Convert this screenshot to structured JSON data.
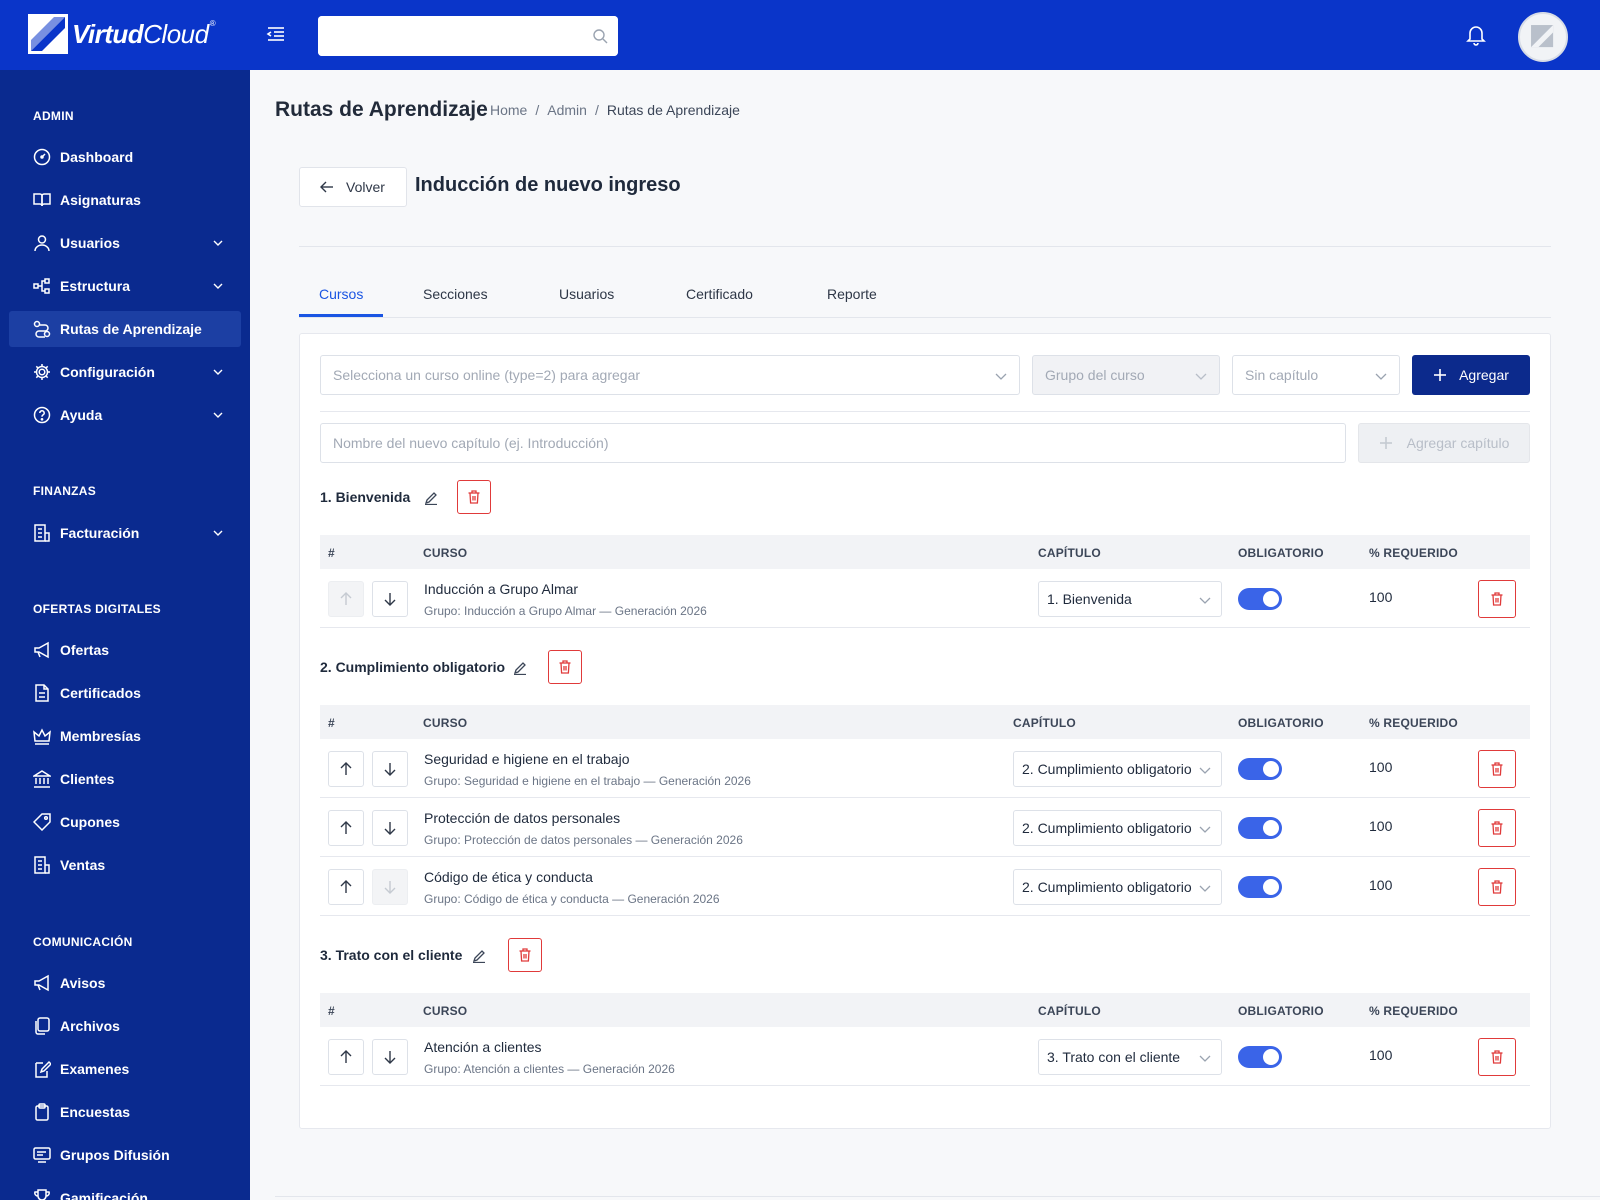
{
  "brand": {
    "name_bold": "Virtud",
    "name_light": "Cloud",
    "mark": "®"
  },
  "header": {
    "search_placeholder": "",
    "search_value": ""
  },
  "sidebar": {
    "sections": [
      {
        "title": "ADMIN",
        "items": [
          {
            "label": "Dashboard",
            "icon": "dashboard-icon",
            "chevron": false
          },
          {
            "label": "Asignaturas",
            "icon": "book-icon",
            "chevron": false
          },
          {
            "label": "Usuarios",
            "icon": "user-icon",
            "chevron": true
          },
          {
            "label": "Estructura",
            "icon": "structure-icon",
            "chevron": true
          },
          {
            "label": "Rutas de Aprendizaje",
            "icon": "route-icon",
            "chevron": false,
            "active": true
          },
          {
            "label": "Configuración",
            "icon": "gear-icon",
            "chevron": true
          },
          {
            "label": "Ayuda",
            "icon": "help-icon",
            "chevron": true
          }
        ]
      },
      {
        "title": "FINANZAS",
        "items": [
          {
            "label": "Facturación",
            "icon": "invoice-icon",
            "chevron": true
          }
        ]
      },
      {
        "title": "OFERTAS DIGITALES",
        "items": [
          {
            "label": "Ofertas",
            "icon": "megaphone-icon",
            "chevron": false
          },
          {
            "label": "Certificados",
            "icon": "certificate-icon",
            "chevron": false
          },
          {
            "label": "Membresías",
            "icon": "crown-icon",
            "chevron": false
          },
          {
            "label": "Clientes",
            "icon": "bank-icon",
            "chevron": false
          },
          {
            "label": "Cupones",
            "icon": "tag-icon",
            "chevron": false
          },
          {
            "label": "Ventas",
            "icon": "receipt-icon",
            "chevron": false
          }
        ]
      },
      {
        "title": "COMUNICACIÓN",
        "items": [
          {
            "label": "Avisos",
            "icon": "megaphone-icon",
            "chevron": false
          },
          {
            "label": "Archivos",
            "icon": "files-icon",
            "chevron": false
          },
          {
            "label": "Examenes",
            "icon": "exam-icon",
            "chevron": false
          },
          {
            "label": "Encuestas",
            "icon": "clipboard-icon",
            "chevron": false
          },
          {
            "label": "Grupos Difusión",
            "icon": "broadcast-icon",
            "chevron": false
          },
          {
            "label": "Gamificación",
            "icon": "trophy-icon",
            "chevron": false
          }
        ]
      }
    ]
  },
  "page": {
    "title": "Rutas de Aprendizaje",
    "breadcrumb": [
      "Home",
      "/",
      "Admin",
      "/",
      "Rutas de Aprendizaje"
    ],
    "back_label": "Volver",
    "route_title": "Inducción de nuevo ingreso"
  },
  "tabs": [
    "Cursos",
    "Secciones",
    "Usuarios",
    "Certificado",
    "Reporte"
  ],
  "add_course": {
    "course_placeholder": "Selecciona un curso online (type=2) para agregar",
    "group_placeholder": "Grupo del curso",
    "chapter_placeholder": "Sin capítulo",
    "add_label": "Agregar"
  },
  "add_chapter": {
    "name_placeholder": "Nombre del nuevo capítulo (ej. Introducción)",
    "add_label": "Agregar capítulo"
  },
  "table_headers": {
    "num": "#",
    "course": "CURSO",
    "chapter": "CAPÍTULO",
    "required": "OBLIGATORIO",
    "pct": "% REQUERIDO"
  },
  "chapters": [
    {
      "title": "1. Bienvenida",
      "rows": [
        {
          "name": "Inducción a Grupo Almar",
          "group": "Grupo: Inducción a Grupo Almar — Generación 2026",
          "chapter": "1. Bienvenida",
          "required": true,
          "pct": "100"
        }
      ]
    },
    {
      "title": "2. Cumplimiento obligatorio",
      "rows": [
        {
          "name": "Seguridad e higiene en el trabajo",
          "group": "Grupo: Seguridad e higiene en el trabajo — Generación 2026",
          "chapter": "2. Cumplimiento obligatorio",
          "required": true,
          "pct": "100"
        },
        {
          "name": "Protección de datos personales",
          "group": "Grupo: Protección de datos personales — Generación 2026",
          "chapter": "2. Cumplimiento obligatorio",
          "required": true,
          "pct": "100"
        },
        {
          "name": "Código de ética y conducta",
          "group": "Grupo: Código de ética y conducta — Generación 2026",
          "chapter": "2. Cumplimiento obligatorio",
          "required": true,
          "pct": "100"
        }
      ]
    },
    {
      "title": "3. Trato con el cliente",
      "rows": [
        {
          "name": "Atención a clientes",
          "group": "Grupo: Atención a clientes — Generación 2026",
          "chapter": "3. Trato con el cliente",
          "required": true,
          "pct": "100"
        }
      ]
    }
  ],
  "colors": {
    "header": "#0a35c9",
    "sidebar": "#0a2a8f",
    "primary": "#0c2a8c",
    "accent": "#1a55e3",
    "danger": "#e03a3a",
    "toggle": "#3a64e8"
  }
}
